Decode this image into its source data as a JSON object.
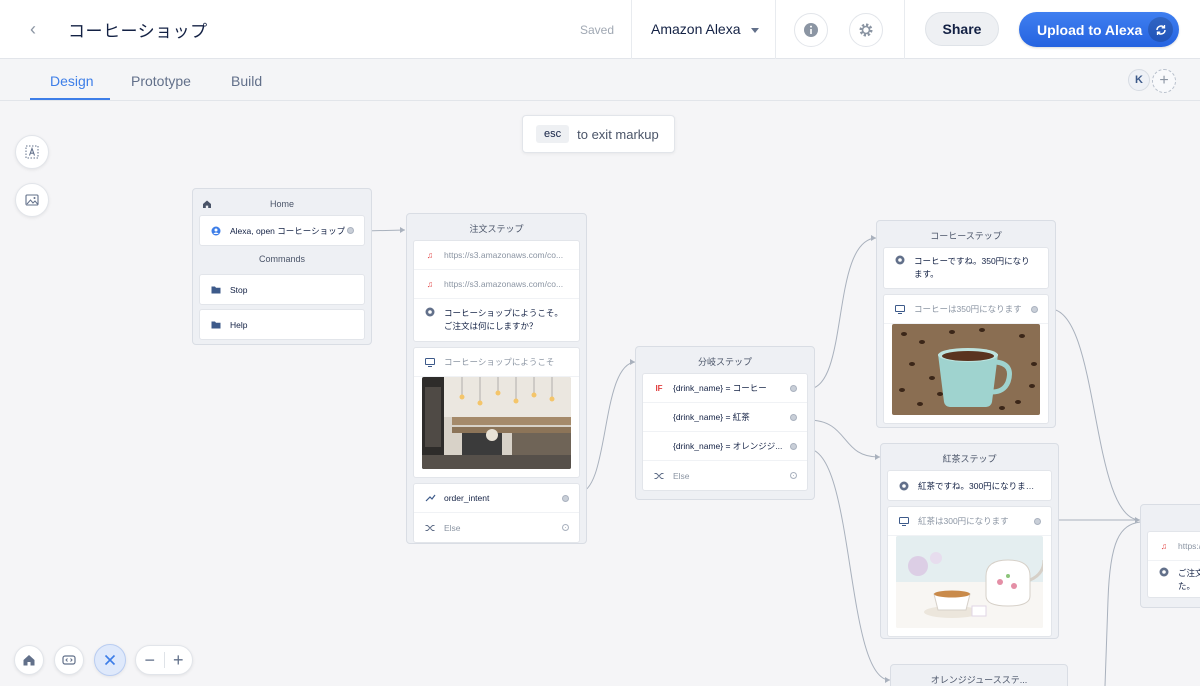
{
  "header": {
    "back_icon": "chevron-left-icon",
    "project_title": "コーヒーショップ",
    "saved_status": "Saved",
    "platform": "Amazon Alexa",
    "share_label": "Share",
    "upload_label": "Upload to Alexa"
  },
  "tabs": [
    {
      "label": "Design",
      "active": true
    },
    {
      "label": "Prototype",
      "active": false
    },
    {
      "label": "Build",
      "active": false
    }
  ],
  "collaborator_initial": "K",
  "markup_hint": {
    "key": "esc",
    "text": "to exit markup"
  },
  "colors": {
    "accent": "#3d7ee8",
    "primary_button": "#2563e0",
    "error_red": "#e03e3e",
    "canvas_bg": "#f5f5f7"
  },
  "blocks": {
    "home": {
      "title": "Home",
      "start_label": "Alexa, open コーヒーショップ",
      "commands_title": "Commands",
      "commands": [
        "Stop",
        "Help"
      ]
    },
    "order": {
      "title": "注文ステップ",
      "audio": [
        "https://s3.amazonaws.com/co...",
        "https://s3.amazonaws.com/co..."
      ],
      "speak": "コーヒーショップにようこそ。ご注文は何にしますか？",
      "card_title": "コーヒーショップにようこそ",
      "intent": "order_intent",
      "else_label": "Else"
    },
    "branch": {
      "title": "分岐ステップ",
      "if_label": "IF",
      "conditions": [
        "{drink_name} = コーヒー",
        "{drink_name} = 紅茶",
        "{drink_name} = オレンジジ..."
      ],
      "else_label": "Else"
    },
    "coffee": {
      "title": "コーヒーステップ",
      "speak": "コーヒーですね。350円になります。",
      "card_title": "コーヒーは350円になります"
    },
    "tea": {
      "title": "紅茶ステップ",
      "speak": "紅茶ですね。300円になります。",
      "card_title": "紅茶は300円になります"
    },
    "orange": {
      "title": "オレンジジュースステ..."
    },
    "partial": {
      "audio": "https:/",
      "speak": "ご注文\nた。"
    }
  }
}
